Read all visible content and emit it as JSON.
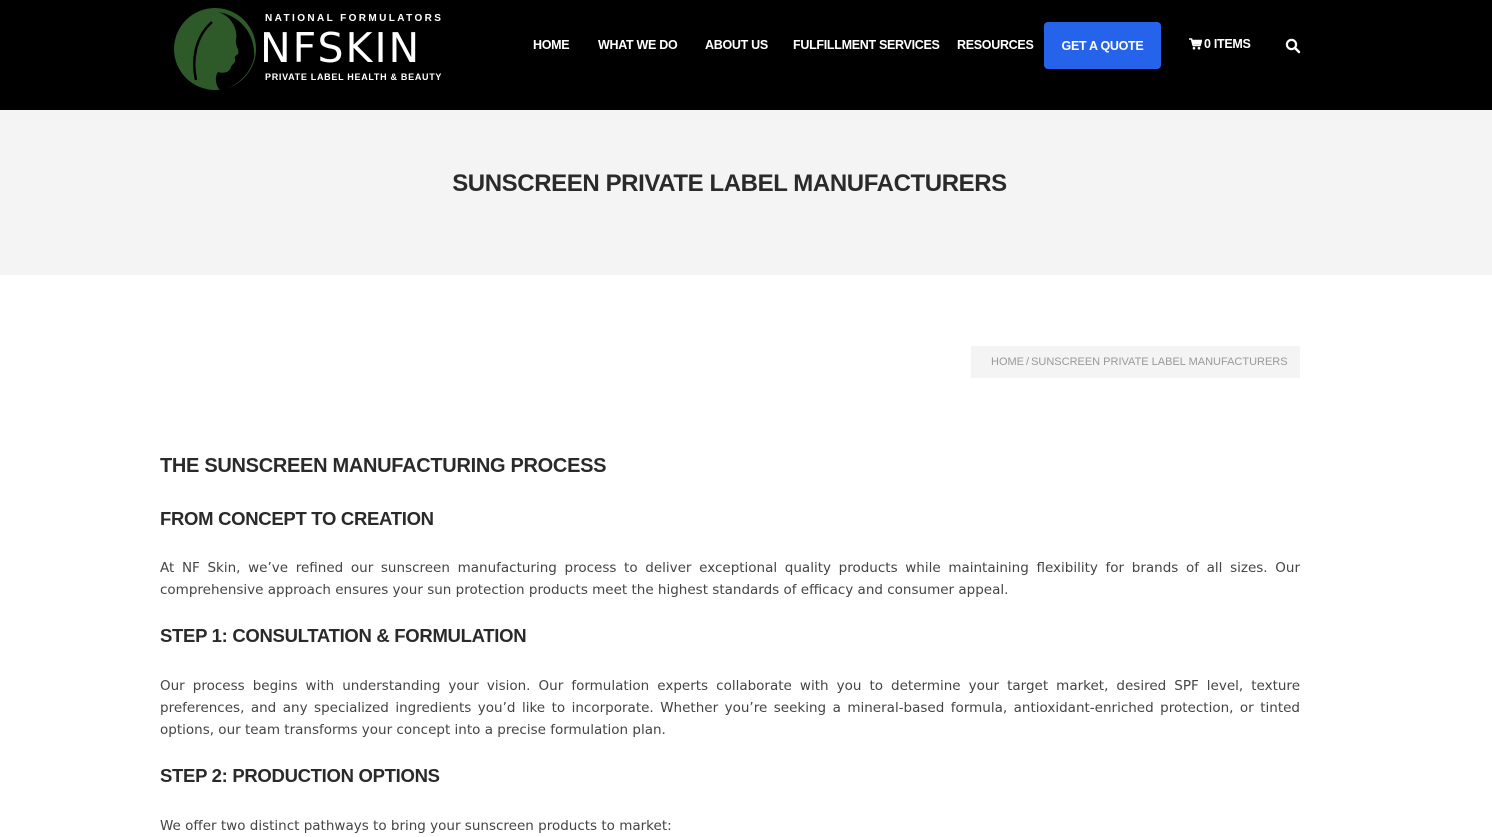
{
  "logo": {
    "top_text": "NATIONAL FORMULATORS",
    "main_text": "NFSKIN",
    "sub_text": "PRIVATE LABEL HEALTH & BEAUTY"
  },
  "nav": {
    "items": [
      {
        "label": "HOME"
      },
      {
        "label": "WHAT WE DO"
      },
      {
        "label": "ABOUT US"
      },
      {
        "label": "FULFILLMENT SERVICES"
      },
      {
        "label": "RESOURCES"
      }
    ],
    "quote_label": "GET A QUOTE",
    "cart_label": "0 ITEMS",
    "cart_icon": "shopping-cart-icon",
    "search_icon": "search-icon"
  },
  "page": {
    "title": "SUNSCREEN PRIVATE LABEL MANUFACTURERS"
  },
  "breadcrumb": {
    "home": "HOME",
    "separator": "/",
    "current": "SUNSCREEN PRIVATE LABEL MANUFACTURERS"
  },
  "content": {
    "heading_main": "THE SUNSCREEN MANUFACTURING PROCESS",
    "heading_concept": "FROM CONCEPT TO CREATION",
    "para_intro": "At NF Skin, we’ve refined our sunscreen manufacturing process to deliver exceptional quality products while maintaining flexibility for brands of all sizes. Our comprehensive approach ensures your sun protection products meet the highest standards of efficacy and consumer appeal.",
    "heading_step1": "STEP 1: CONSULTATION & FORMULATION",
    "para_step1": "Our process begins with understanding your vision. Our formulation experts collaborate with you to determine your target market, desired SPF level, texture preferences, and any specialized ingredients you’d like to incorporate. Whether you’re seeking a mineral-based formula, antioxidant-enriched protection, or tinted options, our team transforms your concept into a precise formulation plan.",
    "heading_step2": "STEP 2: PRODUCTION OPTIONS",
    "para_step2": "We offer two distinct pathways to bring your sunscreen products to market:"
  },
  "colors": {
    "header_bg": "#000000",
    "accent_button": "#2563eb",
    "band_bg": "#f4f4f4",
    "logo_green": "#2e5a2a"
  }
}
